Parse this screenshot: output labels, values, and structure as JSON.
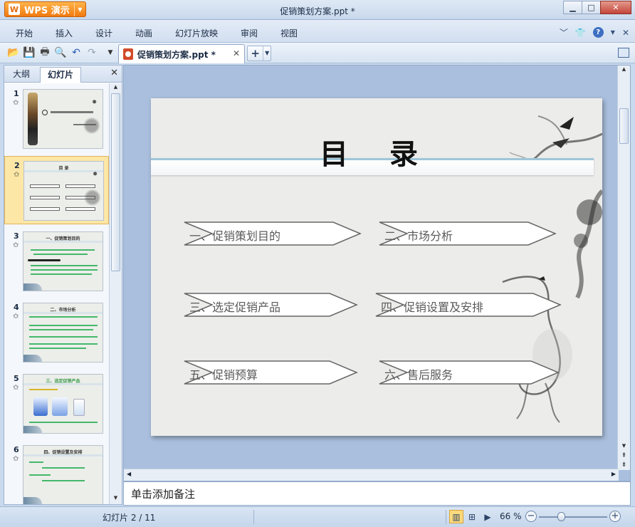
{
  "window": {
    "app_button_label": "WPS 演示",
    "title": "促销策划方案.ppt *"
  },
  "menu": {
    "items": [
      "开始",
      "插入",
      "设计",
      "动画",
      "幻灯片放映",
      "审阅",
      "视图"
    ]
  },
  "toolbar": {
    "doc_tab_label": "促销策划方案.ppt *",
    "new_tab_symbol": "+"
  },
  "left_panel": {
    "tabs": [
      "大纲",
      "幻灯片"
    ],
    "active_tab": "幻灯片",
    "thumbnails": [
      {
        "num": "1",
        "caption": ""
      },
      {
        "num": "2",
        "caption": "目 录"
      },
      {
        "num": "3",
        "caption": "一、促销策划目的"
      },
      {
        "num": "4",
        "caption": "二、市场分析"
      },
      {
        "num": "5",
        "caption": "三、选定促销产品"
      },
      {
        "num": "6",
        "caption": "四、促销设置及安排"
      }
    ],
    "selected_index": 1
  },
  "slide": {
    "title": "目 录",
    "items": [
      {
        "label": "一、促销策划目的"
      },
      {
        "label": "二、市场分析"
      },
      {
        "label": "三、选定促销产品"
      },
      {
        "label": "四、促销设置及安排"
      },
      {
        "label": "五、促销预算"
      },
      {
        "label": "六、售后服务"
      }
    ]
  },
  "notes": {
    "placeholder": "单击添加备注"
  },
  "status": {
    "slide_info": "幻灯片 2 / 11",
    "zoom": "66 %",
    "zoom_fraction": 0.33
  },
  "colors": {
    "accent_orange": "#f07a10",
    "selected_thumb": "#fde7a6",
    "workspace": "#a9bfdd"
  }
}
